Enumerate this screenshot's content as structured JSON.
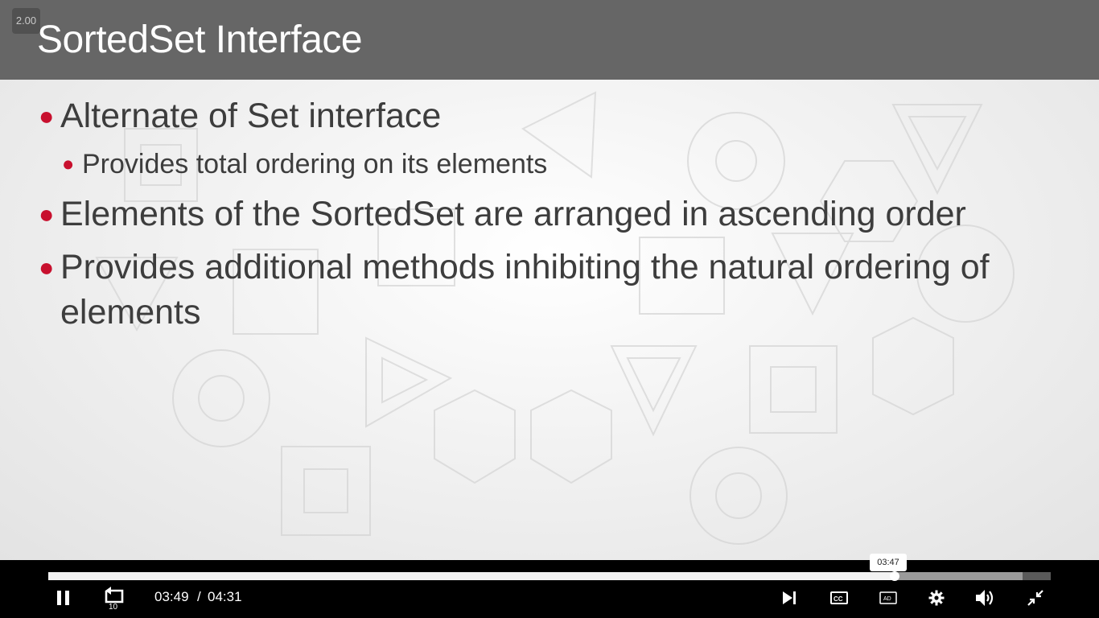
{
  "slide": {
    "title": "SortedSet Interface",
    "speed": "2.00",
    "bullets": [
      {
        "level": 1,
        "text": "Alternate of Set interface"
      },
      {
        "level": 2,
        "text": "Provides total ordering on its elements"
      },
      {
        "level": 1,
        "text": "Elements of the SortedSet are arranged in ascending order"
      },
      {
        "level": 1,
        "text": "Provides additional methods inhibiting the natural ordering of elements"
      }
    ]
  },
  "player": {
    "current_time": "03:49",
    "separator": "/",
    "duration": "04:31",
    "hover_time": "03:47",
    "played_fraction": 0.844,
    "buffered_fraction": 0.972,
    "controls": {
      "play_pause": "pause-icon",
      "rewind": "replay-10-icon",
      "rewind_label": "10",
      "next": "skip-next-icon",
      "captions": "closed-captions-icon",
      "captions_label": "CC",
      "audio_description": "audio-description-icon",
      "audio_description_label": "AD",
      "settings": "gear-icon",
      "volume": "volume-icon",
      "fullscreen": "exit-fullscreen-icon"
    }
  },
  "colors": {
    "title_bar": "#666666",
    "bullet_dot": "#c8102e",
    "text": "#3d3d3d"
  }
}
